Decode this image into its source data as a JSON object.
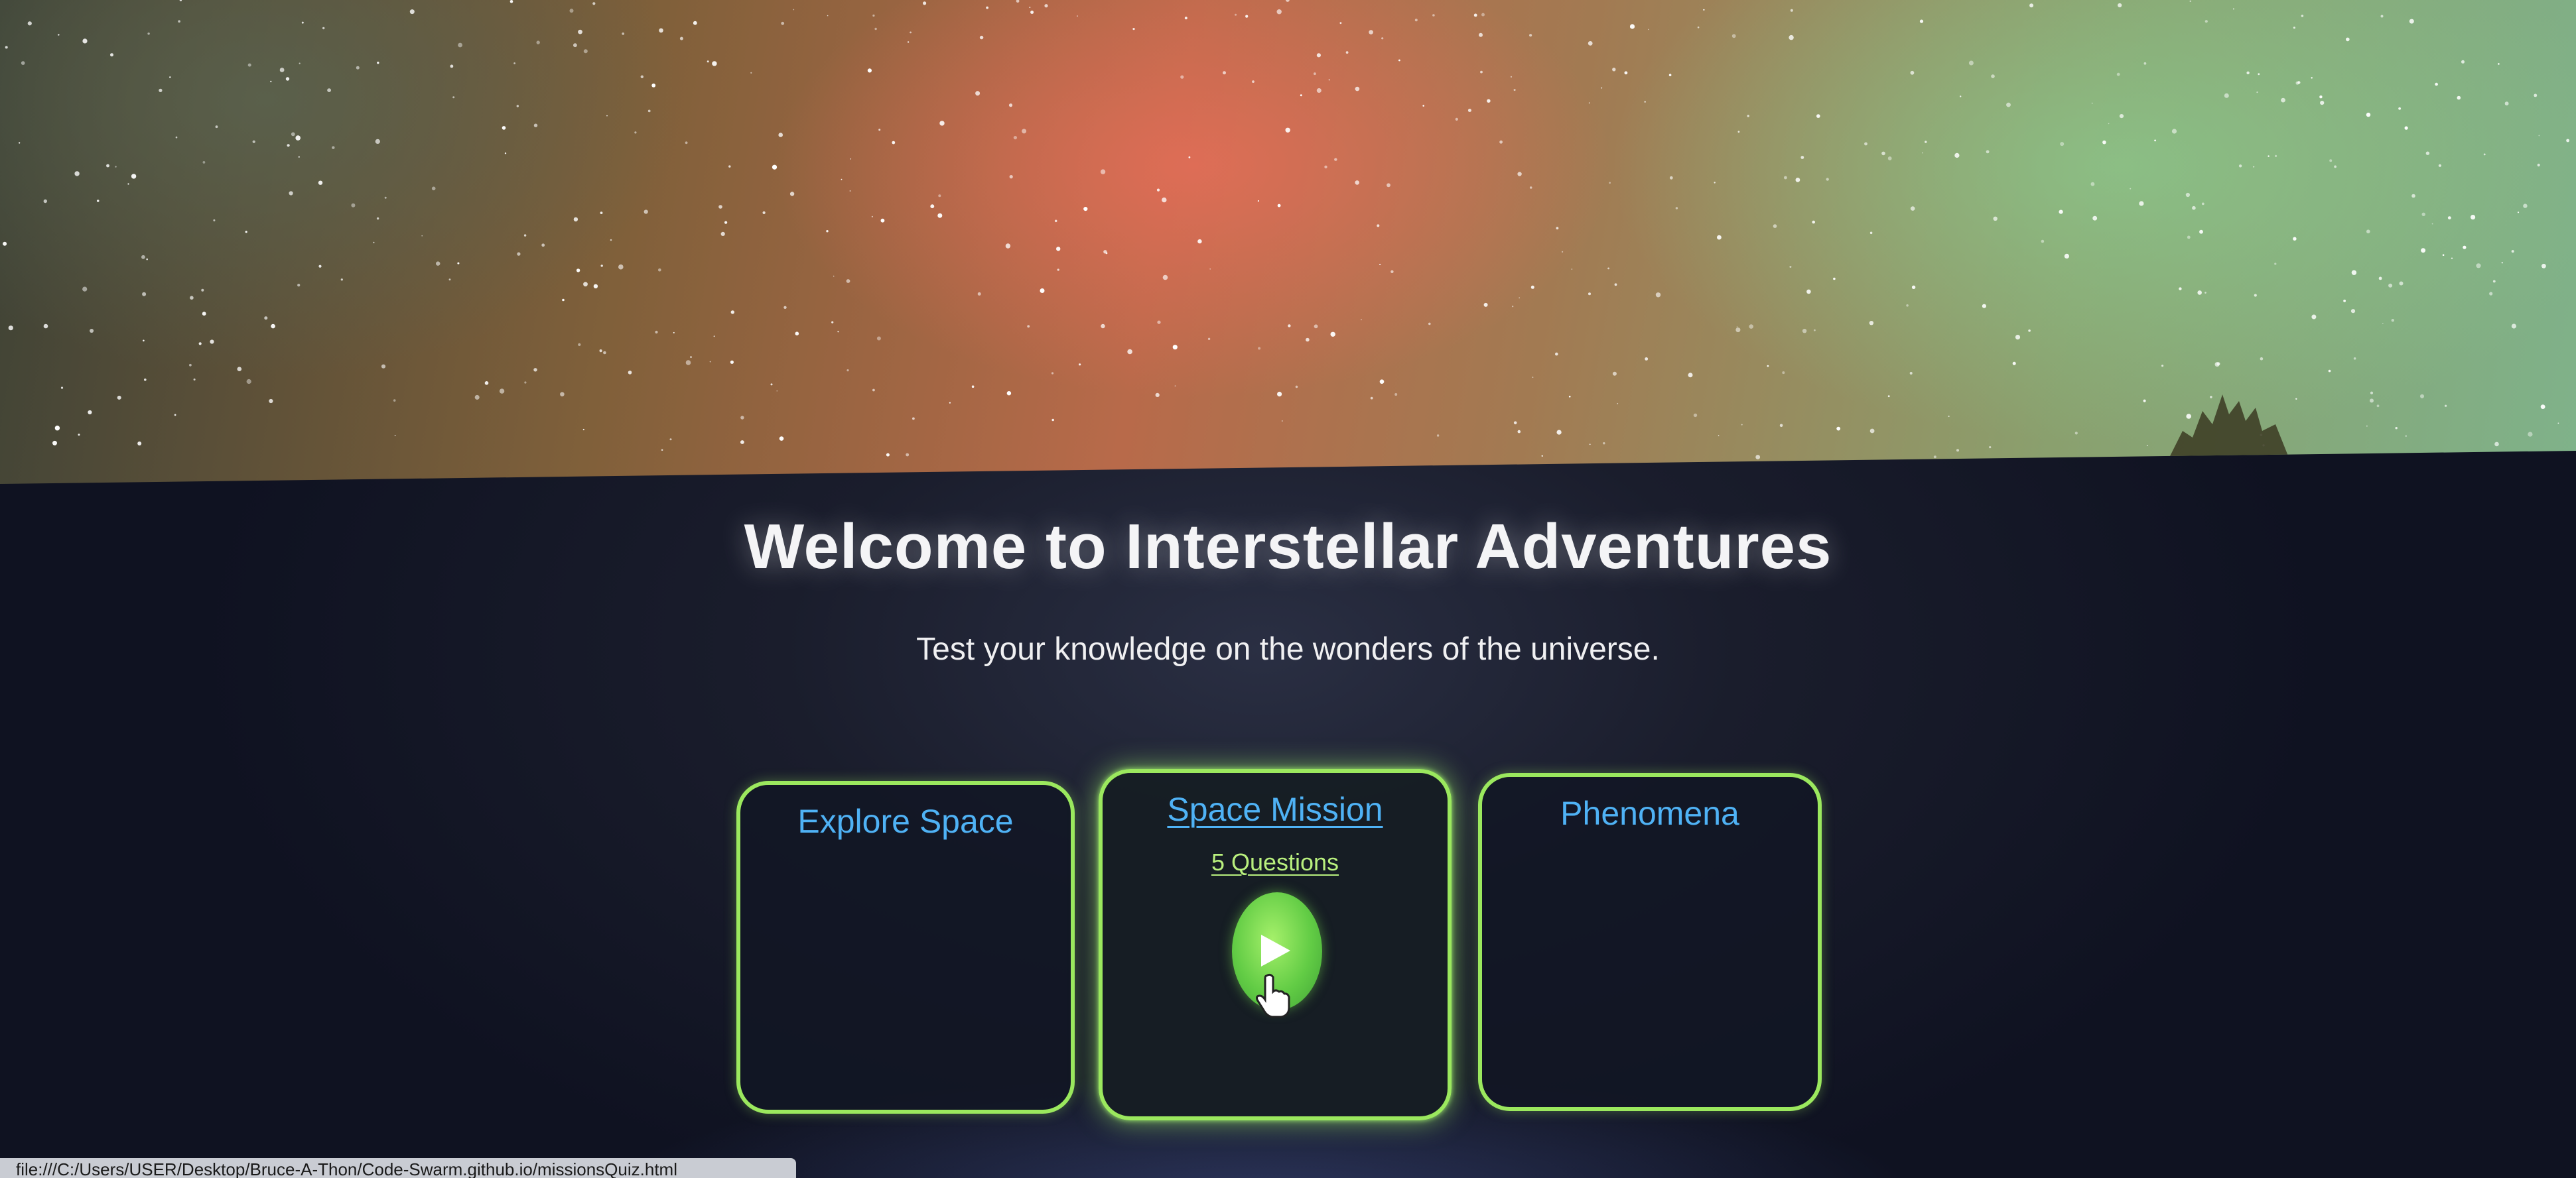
{
  "header": {
    "title": "Welcome to Interstellar Adventures",
    "subtitle": "Test your knowledge on the wonders of the universe."
  },
  "cards": [
    {
      "title": "Explore Space"
    },
    {
      "title": "Space Mission",
      "questions": "5 Questions",
      "action_icon": "play-icon"
    },
    {
      "title": "Phenomena"
    }
  ],
  "status_bar": {
    "url": "file:///C:/Users/USER/Desktop/Bruce-A-Thon/Code-Swarm.github.io/missionsQuiz.html"
  },
  "colors": {
    "card_border": "#9be85e",
    "card_title": "#4fb2f5",
    "questions_link": "#b9f07e",
    "play_button": "#62cc45",
    "background": "#1a1d2c"
  }
}
